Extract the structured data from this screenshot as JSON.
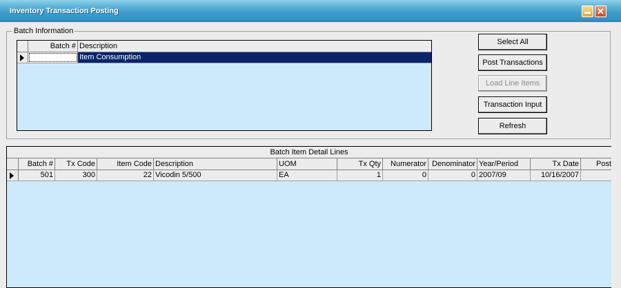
{
  "window": {
    "title": "Inventory Transaction Posting",
    "close_glyph": "✕"
  },
  "batch_info": {
    "label": "Batch Information",
    "columns": [
      "Batch #",
      "Description"
    ],
    "rows": [
      {
        "batch": "",
        "description": "Item Consumption"
      }
    ]
  },
  "buttons": {
    "select_all": "Select All",
    "post_transactions": "Post Transactions",
    "load_line_items": "Load Line Items",
    "transaction_input": "Transaction Input",
    "refresh": "Refresh"
  },
  "detail": {
    "caption": "Batch Item Detail Lines",
    "columns": {
      "batch": "Batch #",
      "tx_code": "Tx Code",
      "item_code": "Item Code",
      "description": "Description",
      "uom": "UOM",
      "tx_qty": "Tx Qty",
      "numerator": "Numerator",
      "denominator": "Denominator",
      "year_period": "Year/Period",
      "tx_date": "Tx Date",
      "post": "Post"
    },
    "rows": [
      {
        "batch": "501",
        "tx_code": "300",
        "item_code": "22",
        "description": "Vicodin 5/500",
        "uom": "EA",
        "tx_qty": "1",
        "numerator": "0",
        "denominator": "0",
        "year_period": "2007/09",
        "tx_date": "10/16/2007",
        "post": ""
      }
    ]
  },
  "colors": {
    "grid_background": "#cdeafc",
    "selection": "#0a246a",
    "titlebar": "#3e9ccc"
  }
}
